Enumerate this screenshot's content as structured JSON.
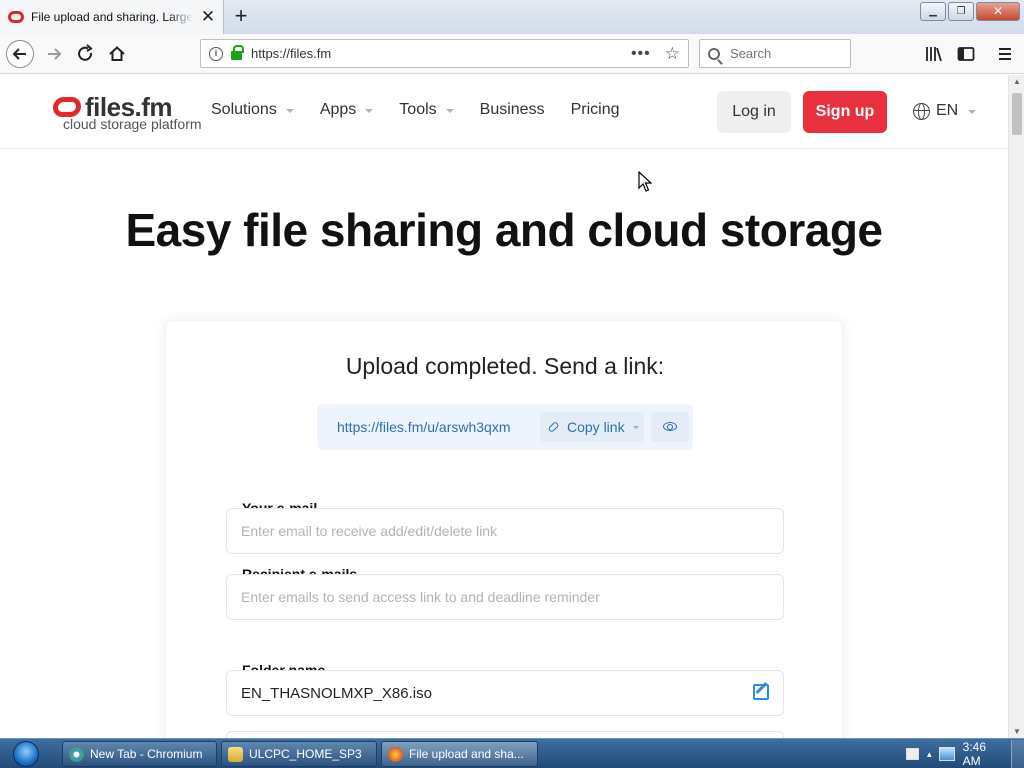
{
  "browser": {
    "tab_title": "File upload and sharing. Large file transfers. Free online cloud storage.",
    "url": "https://files.fm",
    "search_placeholder": "Search"
  },
  "site": {
    "logo_name": "files.fm",
    "logo_tagline": "cloud storage platform",
    "menu": [
      {
        "label": "Solutions",
        "dropdown": true
      },
      {
        "label": "Apps",
        "dropdown": true
      },
      {
        "label": "Tools",
        "dropdown": true
      },
      {
        "label": "Business",
        "dropdown": false
      },
      {
        "label": "Pricing",
        "dropdown": false
      }
    ],
    "login_label": "Log in",
    "signup_label": "Sign up",
    "language": "EN",
    "signup_color": "#e8313c"
  },
  "hero_title": "Easy file sharing and cloud storage",
  "upload": {
    "title": "Upload completed. Send a link:",
    "share_link": "https://files.fm/u/arswh3qxm",
    "copy_link_label": "Copy link",
    "your_email_label": "Your e-mail",
    "your_email_placeholder": "Enter email to receive add/edit/delete link",
    "recipient_label": "Recipient e-mails",
    "recipient_placeholder": "Enter emails to send access link to and deadline reminder",
    "folder_label": "Folder name",
    "folder_value": "EN_THASNOLMXP_X86.iso",
    "link_color": "#2e6eb5"
  },
  "taskbar": {
    "items": [
      {
        "label": "New Tab - Chromium",
        "icon": "chromium-icon"
      },
      {
        "label": "ULCPC_HOME_SP3",
        "icon": "folder-icon"
      },
      {
        "label": "File upload and sha...",
        "icon": "firefox-icon"
      }
    ],
    "clock": "3:46 AM"
  }
}
